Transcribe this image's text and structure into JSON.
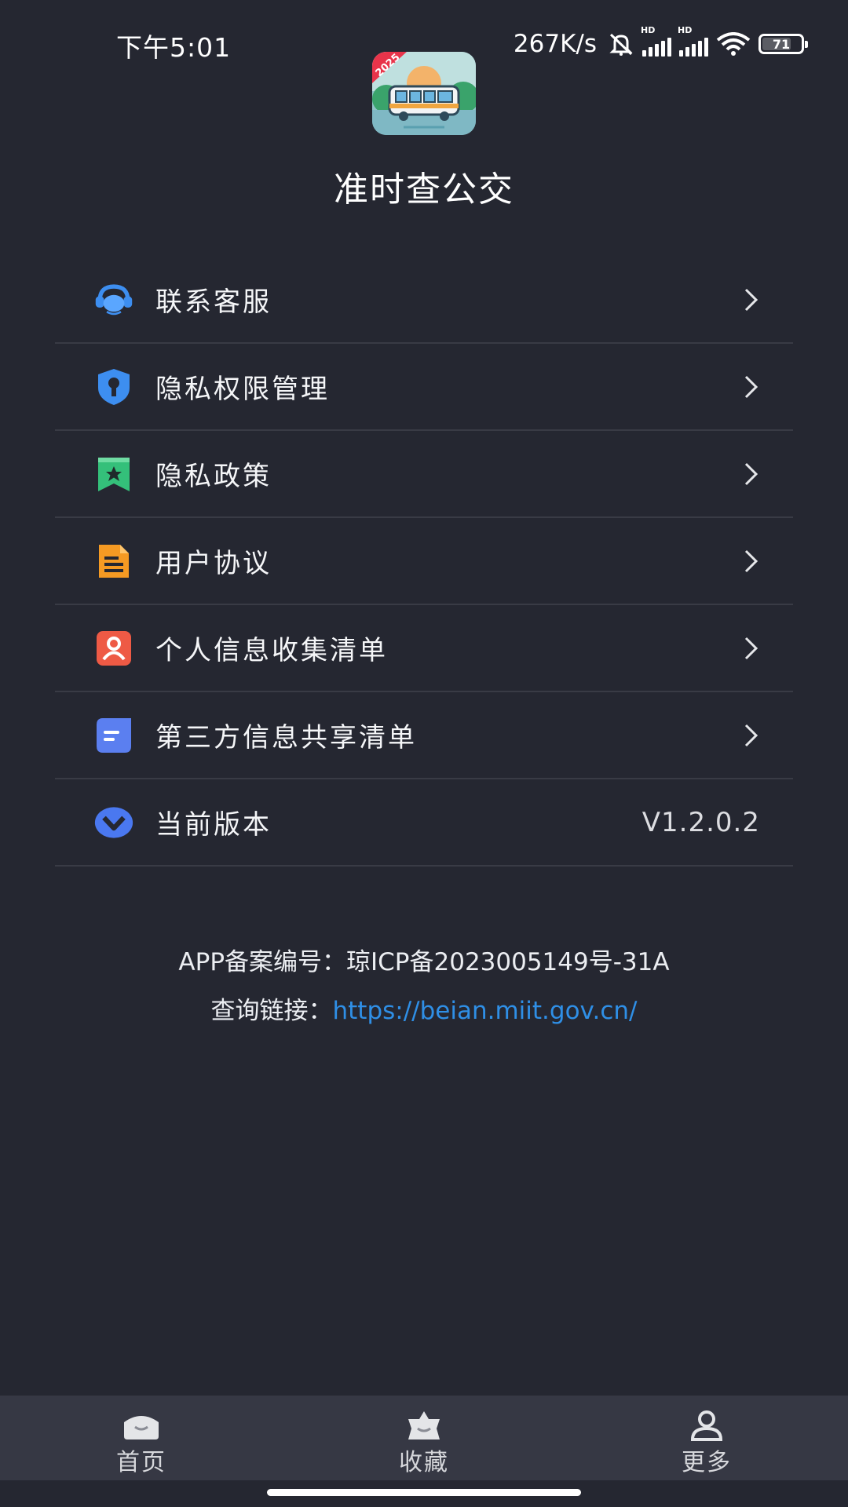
{
  "status_bar": {
    "time": "下午5:01",
    "net_speed": "267K/s",
    "battery": "71",
    "icons": [
      "mute-icon",
      "signal-hd-icon",
      "signal-hd-icon",
      "wifi-icon",
      "battery-icon"
    ]
  },
  "app": {
    "title": "准时查公交",
    "logo_badge": "2025"
  },
  "menu": {
    "items": [
      {
        "label": "联系客服",
        "icon": "headset-icon",
        "color": "#3d8ef0"
      },
      {
        "label": "隐私权限管理",
        "icon": "shield-key-icon",
        "color": "#3d8ef0"
      },
      {
        "label": "隐私政策",
        "icon": "bookmark-star-icon",
        "color": "#34c07a"
      },
      {
        "label": "用户协议",
        "icon": "document-icon",
        "color": "#f59a23"
      },
      {
        "label": "个人信息收集清单",
        "icon": "person-icon",
        "color": "#ee5a45"
      },
      {
        "label": "第三方信息共享清单",
        "icon": "list-icon",
        "color": "#5b7ff0"
      },
      {
        "label": "当前版本",
        "icon": "version-icon",
        "color": "#4a78f0",
        "value": "V1.2.0.2"
      }
    ]
  },
  "icp": {
    "record": "APP备案编号：琼ICP备2023005149号-31A",
    "query_label": "查询链接：",
    "query_url": "https://beian.miit.gov.cn/"
  },
  "tabbar": {
    "tabs": [
      {
        "label": "首页",
        "icon": "home-icon"
      },
      {
        "label": "收藏",
        "icon": "favorites-icon"
      },
      {
        "label": "更多",
        "icon": "user-icon"
      }
    ]
  },
  "colors": {
    "background": "#252731",
    "divider": "#393b45",
    "tabbar": "#363844",
    "link": "#2f8fe6"
  }
}
